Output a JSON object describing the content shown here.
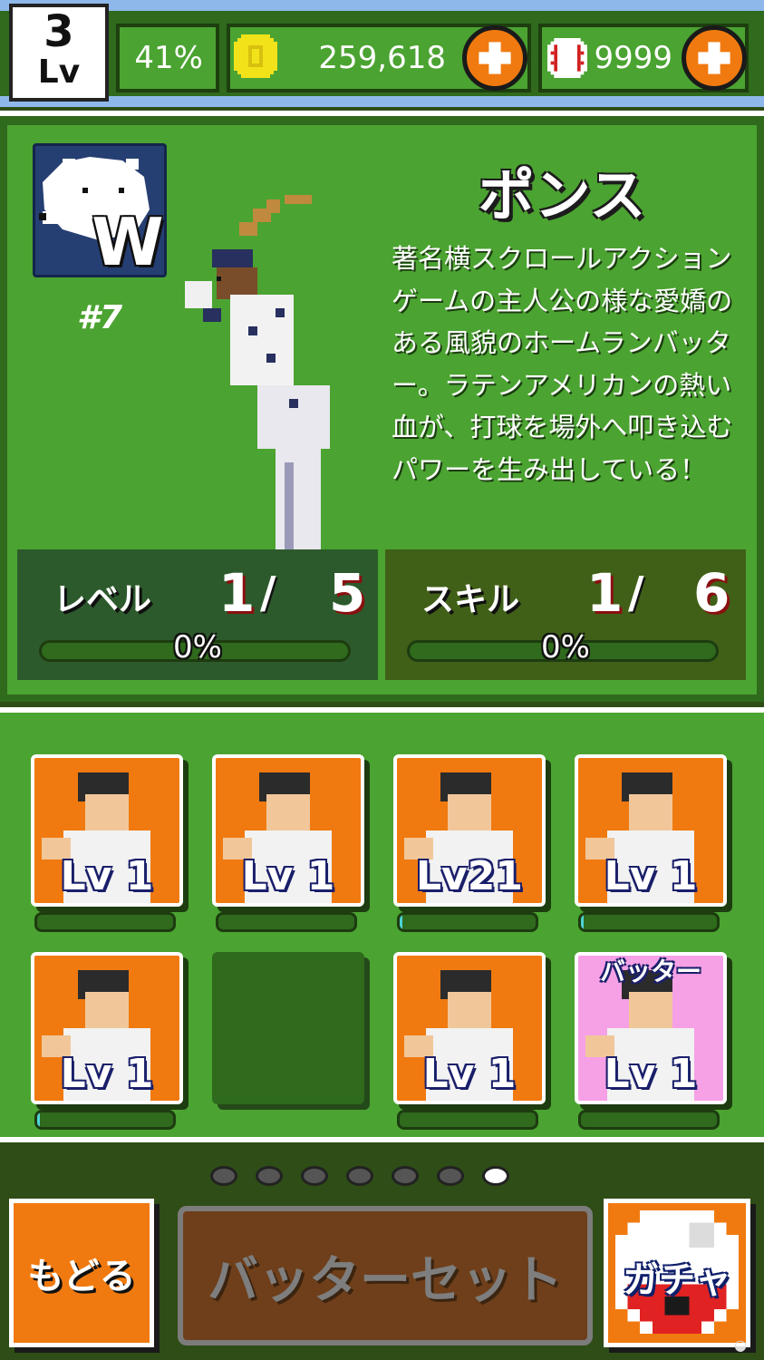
{
  "header": {
    "level_number": "3",
    "level_label": "Lv",
    "exp_percent": "41%",
    "coins": "259,618",
    "balls": "9999",
    "coin_icon": "coin-icon",
    "ball_icon": "baseball-icon",
    "plus_icon": "plus-icon"
  },
  "player": {
    "name": "ポンス",
    "uniform_number": "#7",
    "team_logo_letter": "W",
    "description": "著名横スクロールアクションゲームの主人公の様な愛嬌のある風貌のホームランバッター。ラテンアメリカンの熱い血が、打球を場外へ叩き込むパワーを生み出している！",
    "level": {
      "label": "レベル",
      "current": "1",
      "max": "5",
      "progress_text": "0%",
      "progress": 0
    },
    "skill": {
      "label": "スキル",
      "current": "1",
      "max": "6",
      "progress_text": "0%",
      "progress": 0
    }
  },
  "roster": [
    {
      "level_text": "Lv 1",
      "style": "orange",
      "progress": 0.0,
      "tag": ""
    },
    {
      "level_text": "Lv 1",
      "style": "orange",
      "progress": 0.0,
      "tag": ""
    },
    {
      "level_text": "Lv21",
      "style": "orange",
      "progress": 0.02,
      "tag": ""
    },
    {
      "level_text": "Lv 1",
      "style": "orange",
      "progress": 0.02,
      "tag": ""
    },
    {
      "level_text": "Lv 1",
      "style": "orange",
      "progress": 0.02,
      "tag": ""
    },
    {
      "level_text": "",
      "style": "empty",
      "progress": null,
      "tag": ""
    },
    {
      "level_text": "Lv 1",
      "style": "orange",
      "progress": 0.0,
      "tag": ""
    },
    {
      "level_text": "Lv 1",
      "style": "pink",
      "progress": 0.0,
      "tag": "バッター"
    }
  ],
  "pager": {
    "total": 7,
    "active": 7
  },
  "buttons": {
    "back": "もどる",
    "batter_set": "バッターセット",
    "gacha": "ガチャ"
  },
  "colors": {
    "field_green": "#4ba331",
    "dark_green": "#2f6a1d",
    "accent_orange": "#f07a10",
    "progress_cyan": "#4fd3d8"
  }
}
